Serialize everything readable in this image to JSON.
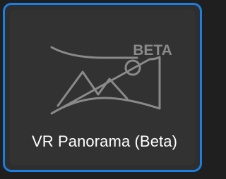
{
  "tile": {
    "label": "VR Panorama (Beta)",
    "badge": "BETA",
    "icon": "vr-panorama-icon",
    "state": "selected"
  },
  "colors": {
    "selection_border": "#1b7ee0",
    "tile_background": "#323232",
    "icon_stroke": "#8a8a8a",
    "label_text": "#ffffff"
  }
}
